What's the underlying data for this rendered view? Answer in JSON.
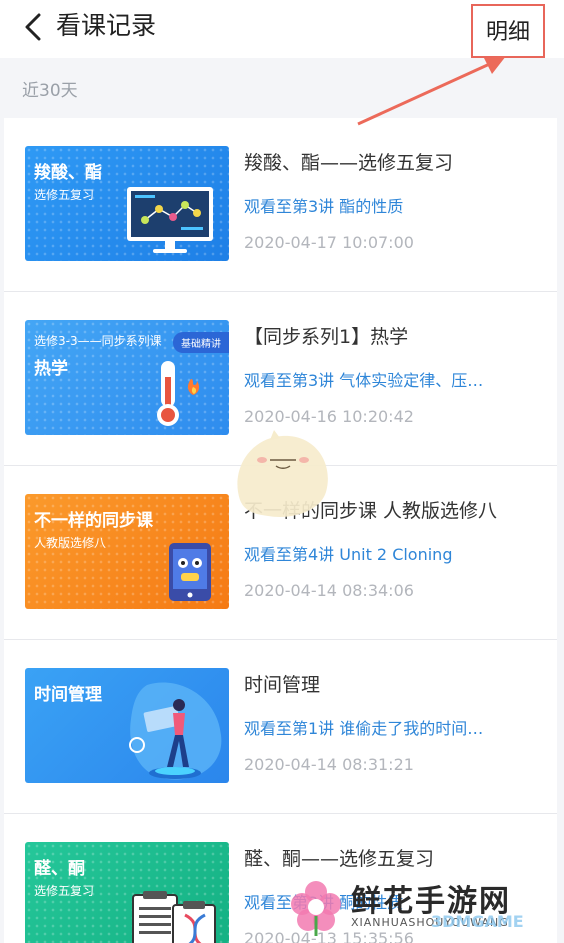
{
  "header": {
    "title": "看课记录",
    "detail_label": "明细"
  },
  "section": {
    "label": "近30天"
  },
  "courses": [
    {
      "thumb_title": "羧酸、酯",
      "thumb_sub": "选修五复习",
      "title": "羧酸、酯——选修五复习",
      "progress": "观看至第3讲  酯的性质",
      "time": "2020-04-17 10:07:00",
      "color": "#2c8ff0"
    },
    {
      "thumb_title": "热学",
      "thumb_sub": "选修3-3——同步系列课",
      "thumb_badge": "基础精讲",
      "title": "【同步系列1】热学",
      "progress": "观看至第3讲  气体实验定律、压…",
      "time": "2020-04-16 10:20:42",
      "color": "#3a9bf0"
    },
    {
      "thumb_title": "不一样的同步课",
      "thumb_sub": "人教版选修八",
      "title": "不一样的同步课 人教版选修八",
      "progress": "观看至第4讲  Unit 2 Cloning",
      "time": "2020-04-14 08:34:06",
      "color": "#f7881f"
    },
    {
      "thumb_title": "时间管理",
      "thumb_sub": "",
      "title": "时间管理",
      "progress": "观看至第1讲  谁偷走了我的时间…",
      "time": "2020-04-14 08:31:21",
      "color": "#2f8ef0"
    },
    {
      "thumb_title": "醛、酮",
      "thumb_sub": "选修五复习",
      "title": "醛、酮——选修五复习",
      "progress": "观看至第3讲  酮的性质",
      "time": "2020-04-13 15:35:56",
      "color": "#1fbf8f"
    }
  ],
  "watermark": {
    "name": "鲜花手游网",
    "pinyin": "XIANHUASHOUYOUWANG",
    "brand": "3DMGAME"
  }
}
